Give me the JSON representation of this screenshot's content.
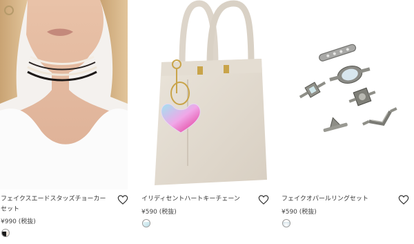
{
  "products": [
    {
      "name": "フェイクスエードスタッズチョーカーセット",
      "price": "¥990 (税抜)",
      "image": "model-wearing-layered-choker-necklaces",
      "swatch_colors": [
        "#1a1a1a",
        "#f1e7dd"
      ]
    },
    {
      "name": "イリディセントハートキーチェーン",
      "price": "¥590 (税抜)",
      "image": "cream-handbag-with-iridescent-heart-keychain",
      "swatch_colors": [
        "#c7e3ea"
      ]
    },
    {
      "name": "フェイクオパールリングセット",
      "price": "¥590 (税抜)",
      "image": "silver-faux-opal-ring-set",
      "swatch_colors": [
        "#d6e3ea"
      ]
    }
  ],
  "icons": {
    "favorite": "heart-outline-icon"
  }
}
